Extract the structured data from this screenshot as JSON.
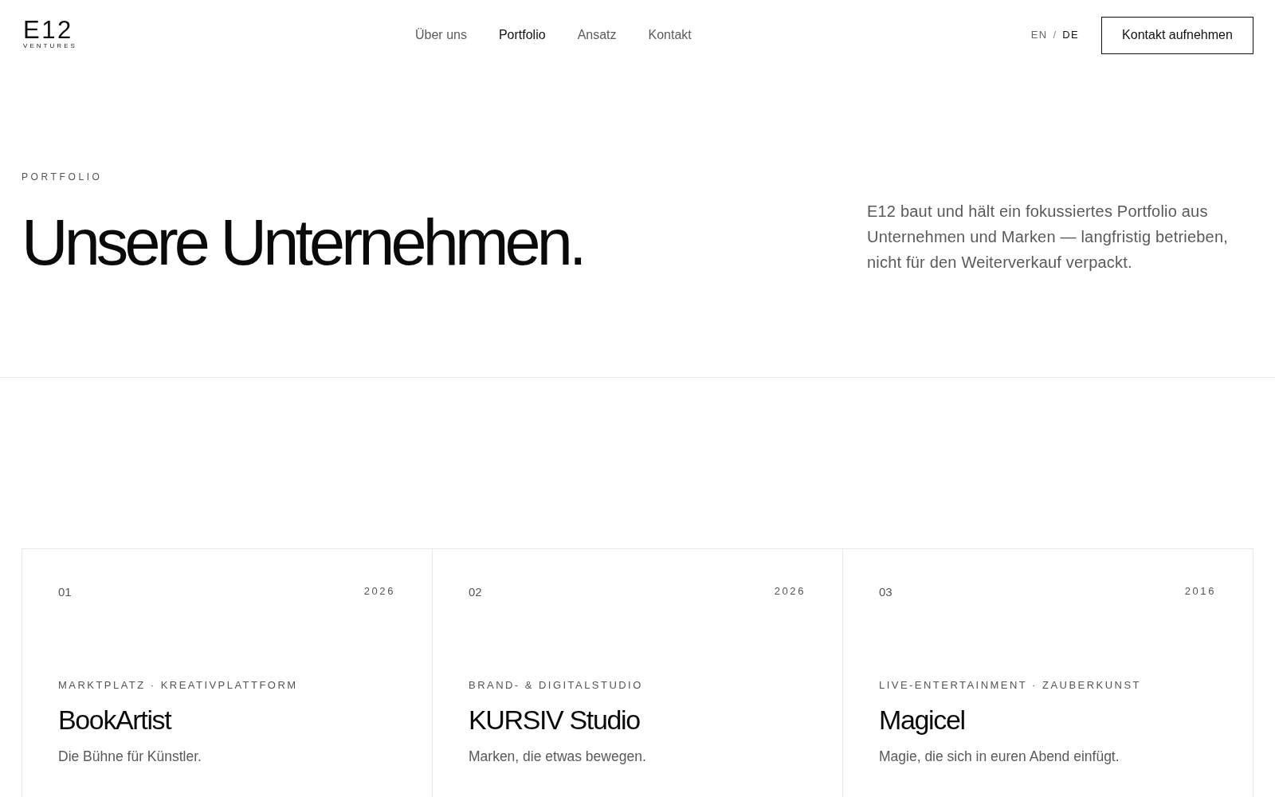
{
  "header": {
    "logo": {
      "mark": "E12",
      "tagline": "VENTURES"
    },
    "nav": [
      {
        "label": "Über uns",
        "selected": false
      },
      {
        "label": "Portfolio",
        "selected": true
      },
      {
        "label": "Ansatz",
        "selected": false
      },
      {
        "label": "Kontakt",
        "selected": false
      }
    ],
    "languages": [
      {
        "label": "EN",
        "selected": false
      },
      {
        "label": "DE",
        "selected": true
      }
    ],
    "language_separator": "/",
    "cta": "Kontakt aufnehmen"
  },
  "hero": {
    "eyebrow": "PORTFOLIO",
    "heading": "Unsere Unternehmen.",
    "intro": "E12 baut und hält ein fokussiertes Portfolio aus Unternehmen und Marken — langfristig betrieben, nicht für den Weiterverkauf verpackt."
  },
  "companies": [
    {
      "number": "01",
      "year": "2026",
      "category": "MARKTPLATZ · KREATIVPLATTFORM",
      "name": "BookArtist",
      "tagline": "Die Bühne für Künstler."
    },
    {
      "number": "02",
      "year": "2026",
      "category": "BRAND- & DIGITALSTUDIO",
      "name": "KURSIV Studio",
      "tagline": "Marken, die etwas bewegen."
    },
    {
      "number": "03",
      "year": "2016",
      "category": "LIVE-ENTERTAINMENT · ZAUBERKUNST",
      "name": "Magicel",
      "tagline": "Magie, die sich in euren Abend einfügt."
    }
  ]
}
